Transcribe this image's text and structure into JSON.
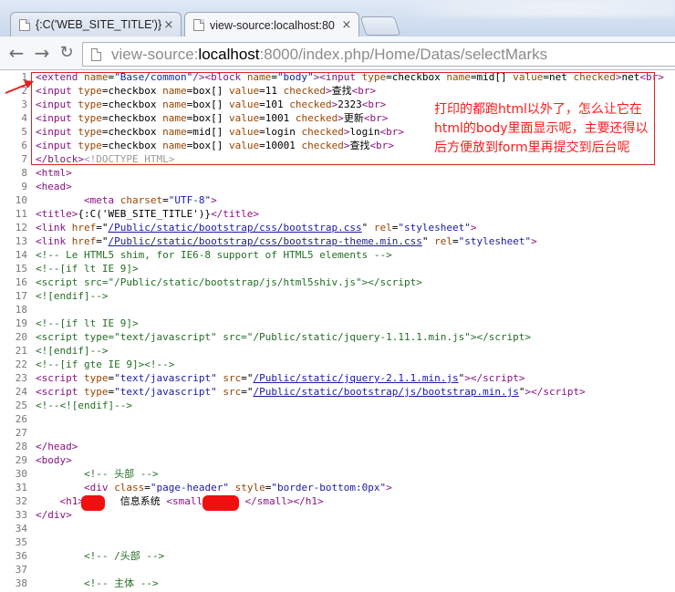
{
  "browser": {
    "tabs": [
      {
        "title": "{:C('WEB_SITE_TITLE')}",
        "active": false
      },
      {
        "title": "view-source:localhost:80",
        "active": true
      }
    ],
    "close_glyph": "×",
    "icons": [
      "back-arrow-icon",
      "forward-arrow-icon",
      "reload-icon",
      "page-icon",
      "close-icon"
    ],
    "address": {
      "scheme": "view-source:",
      "host": "localhost",
      "path": ":8000/index.php/Home/Datas/selectMarks"
    }
  },
  "source_lines": [
    {
      "n": "1",
      "html": "<span class=\"t\">&lt;extend</span> <span class=\"a\">name</span>=<span class=\"v\">\"Base/common\"</span><span class=\"t\">/&gt;&lt;block</span> <span class=\"a\">name</span>=<span class=\"v\">\"body\"</span><span class=\"t\">&gt;&lt;input</span> <span class=\"a\">type</span>=checkbox <span class=\"a\">name</span>=mid[] <span class=\"a\">value</span>=net <span class=\"a\">checked</span><span class=\"t\">&gt;</span>net<span class=\"t\">&lt;br&gt;</span>"
    },
    {
      "n": "2",
      "html": "<span class=\"t\">&lt;input</span> <span class=\"a\">type</span>=checkbox <span class=\"a\">name</span>=box[] <span class=\"a\">value</span>=11 <span class=\"a\">checked</span><span class=\"t\">&gt;</span><span class=\"cn\">查找</span><span class=\"t\">&lt;br&gt;</span>"
    },
    {
      "n": "3",
      "html": "<span class=\"t\">&lt;input</span> <span class=\"a\">type</span>=checkbox <span class=\"a\">name</span>=box[] <span class=\"a\">value</span>=101 <span class=\"a\">checked</span><span class=\"t\">&gt;</span>2323<span class=\"t\">&lt;br&gt;</span>"
    },
    {
      "n": "4",
      "html": "<span class=\"t\">&lt;input</span> <span class=\"a\">type</span>=checkbox <span class=\"a\">name</span>=box[] <span class=\"a\">value</span>=1001 <span class=\"a\">checked</span><span class=\"t\">&gt;</span><span class=\"cn\">更新</span><span class=\"t\">&lt;br&gt;</span>"
    },
    {
      "n": "5",
      "html": "<span class=\"t\">&lt;input</span> <span class=\"a\">type</span>=checkbox <span class=\"a\">name</span>=mid[] <span class=\"a\">value</span>=login <span class=\"a\">checked</span><span class=\"t\">&gt;</span>login<span class=\"t\">&lt;br&gt;</span>"
    },
    {
      "n": "6",
      "html": "<span class=\"t\">&lt;input</span> <span class=\"a\">type</span>=checkbox <span class=\"a\">name</span>=box[] <span class=\"a\">value</span>=10001 <span class=\"a\">checked</span><span class=\"t\">&gt;</span><span class=\"cn\">查找</span><span class=\"t\">&lt;br&gt;</span>"
    },
    {
      "n": "7",
      "html": "<span class=\"t\">&lt;/block&gt;</span><span class=\"gr\">&lt;!DOCTYPE HTML&gt;</span>"
    },
    {
      "n": "8",
      "html": "<span class=\"t\">&lt;html&gt;</span>"
    },
    {
      "n": "9",
      "html": "<span class=\"t\">&lt;head&gt;</span>"
    },
    {
      "n": "10",
      "html": "        <span class=\"t\">&lt;meta</span> <span class=\"a\">charset</span>=<span class=\"v\">\"UTF-8\"</span><span class=\"t\">&gt;</span>"
    },
    {
      "n": "11",
      "html": "<span class=\"t\">&lt;title&gt;</span>{:C('WEB_SITE_TITLE')}<span class=\"t\">&lt;/title&gt;</span>"
    },
    {
      "n": "12",
      "html": "<span class=\"t\">&lt;link</span> <span class=\"a\">href</span>=\"<span class=\"lk\">/Public/static/bootstrap/css/bootstrap.css</span>\" <span class=\"a\">rel</span>=<span class=\"v\">\"stylesheet\"</span><span class=\"t\">&gt;</span>"
    },
    {
      "n": "13",
      "html": "<span class=\"t\">&lt;link</span> <span class=\"a\">href</span>=\"<span class=\"lk\">/Public/static/bootstrap/css/bootstrap-theme.min.css</span>\" <span class=\"a\">rel</span>=<span class=\"v\">\"stylesheet\"</span><span class=\"t\">&gt;</span>"
    },
    {
      "n": "14",
      "html": "<span class=\"c\">&lt;!-- Le HTML5 shim, for IE6-8 support of HTML5 elements --&gt;</span>"
    },
    {
      "n": "15",
      "html": "<span class=\"c\">&lt;!--[if lt IE 9]&gt;</span>"
    },
    {
      "n": "16",
      "html": "<span class=\"c\">&lt;script src=\"/Public/static/bootstrap/js/html5shiv.js\"&gt;&lt;/script&gt;</span>"
    },
    {
      "n": "17",
      "html": "<span class=\"c\">&lt;![endif]--&gt;</span>"
    },
    {
      "n": "18",
      "html": ""
    },
    {
      "n": "19",
      "html": "<span class=\"c\">&lt;!--[if lt IE 9]&gt;</span>"
    },
    {
      "n": "20",
      "html": "<span class=\"c\">&lt;script type=\"text/javascript\" src=\"/Public/static/jquery-1.11.1.min.js\"&gt;&lt;/script&gt;</span>"
    },
    {
      "n": "21",
      "html": "<span class=\"c\">&lt;![endif]--&gt;</span>"
    },
    {
      "n": "22",
      "html": "<span class=\"c\">&lt;!--[if gte IE 9]&gt;&lt;!--&gt;</span>"
    },
    {
      "n": "23",
      "html": "<span class=\"t\">&lt;script</span> <span class=\"a\">type</span>=<span class=\"v\">\"text/javascript\"</span> <span class=\"a\">src</span>=\"<span class=\"lk\">/Public/static/jquery-2.1.1.min.js</span>\"<span class=\"t\">&gt;&lt;/script&gt;</span>"
    },
    {
      "n": "24",
      "html": "<span class=\"t\">&lt;script</span> <span class=\"a\">type</span>=<span class=\"v\">\"text/javascript\"</span> <span class=\"a\">src</span>=\"<span class=\"lk\">/Public/static/bootstrap/js/bootstrap.min.js</span>\"<span class=\"t\">&gt;&lt;/script&gt;</span>"
    },
    {
      "n": "25",
      "html": "<span class=\"c\">&lt;!--&lt;![endif]--&gt;</span>"
    },
    {
      "n": "26",
      "html": ""
    },
    {
      "n": "27",
      "html": ""
    },
    {
      "n": "28",
      "html": "<span class=\"t\">&lt;/head&gt;</span>"
    },
    {
      "n": "29",
      "html": "<span class=\"t\">&lt;body&gt;</span>"
    },
    {
      "n": "30",
      "html": "        <span class=\"c\">&lt;!-- <span class=\"cn\">头部</span> --&gt;</span>"
    },
    {
      "n": "31",
      "html": "        <span class=\"t\">&lt;div</span> <span class=\"a\">class</span>=<span class=\"v\">\"page-header\"</span> <span class=\"a\">style</span>=<span class=\"v\">\"border-bottom:0px\"</span><span class=\"t\">&gt;</span>"
    },
    {
      "n": "32",
      "html": "    <span class=\"t\">&lt;h1&gt;</span>      <span class=\"cn\">信息系统</span> <span class=\"t\">&lt;small&gt;</span>      <span class=\"t\">&lt;/small&gt;&lt;/h1&gt;</span>"
    },
    {
      "n": "33",
      "html": "<span class=\"t\">&lt;/div&gt;</span>"
    },
    {
      "n": "34",
      "html": ""
    },
    {
      "n": "35",
      "html": ""
    },
    {
      "n": "36",
      "html": "        <span class=\"c\">&lt;!-- /<span class=\"cn\">头部</span> --&gt;</span>"
    },
    {
      "n": "37",
      "html": ""
    },
    {
      "n": "38",
      "html": "        <span class=\"c\">&lt;!-- <span class=\"cn\">主体</span> --&gt;</span>"
    }
  ],
  "annotation": {
    "note": "打印的都跑html以外了，怎么让它在\nhtml的body里面显示呢，主要还得以\n后方便放到form里再提交到后台呢",
    "color": "#ff1a1a"
  }
}
